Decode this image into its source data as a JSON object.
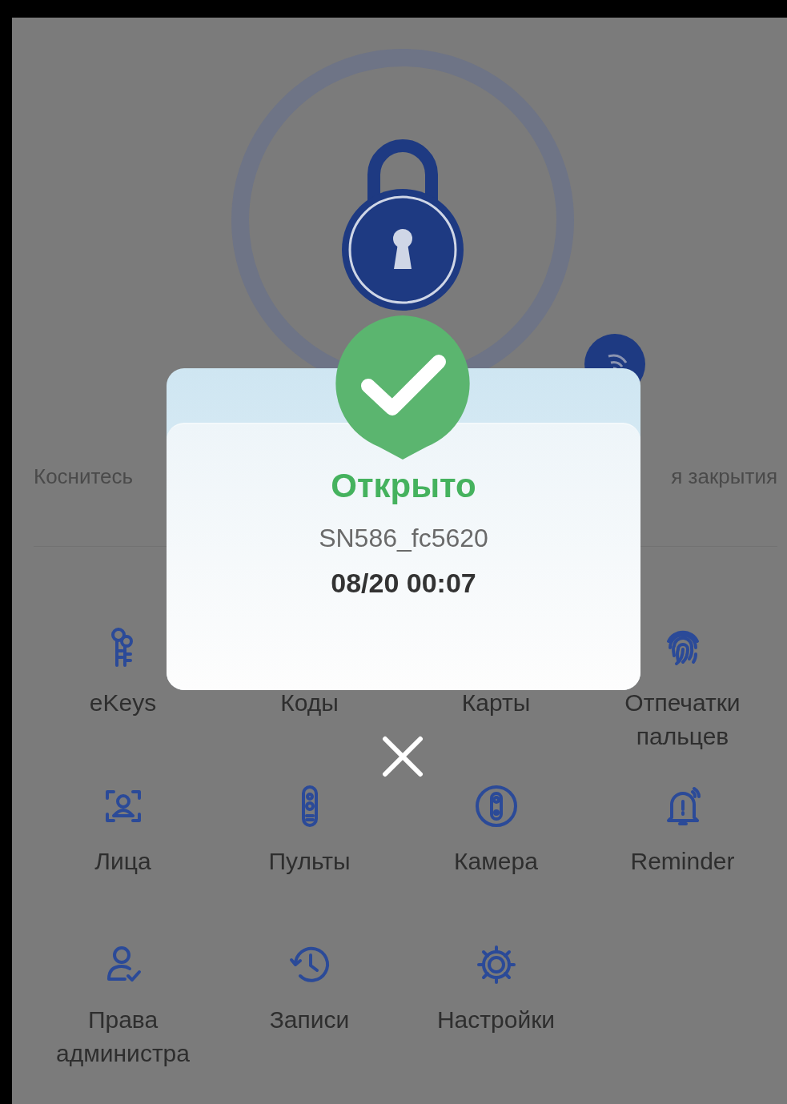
{
  "lock": {
    "hint_left": "Коснитесь",
    "hint_right": "я закрытия"
  },
  "menu": [
    {
      "label": "eKeys"
    },
    {
      "label": "Коды"
    },
    {
      "label": "Карты"
    },
    {
      "label": "Отпечатки пальцев"
    },
    {
      "label": "Лица"
    },
    {
      "label": "Пульты"
    },
    {
      "label": "Камера"
    },
    {
      "label": "Reminder"
    },
    {
      "label": "Права администра"
    },
    {
      "label": "Записи"
    },
    {
      "label": "Настройки"
    }
  ],
  "dialog": {
    "title": "Открыто",
    "device": "SN586_fc5620",
    "time": "08/20 00:07"
  }
}
